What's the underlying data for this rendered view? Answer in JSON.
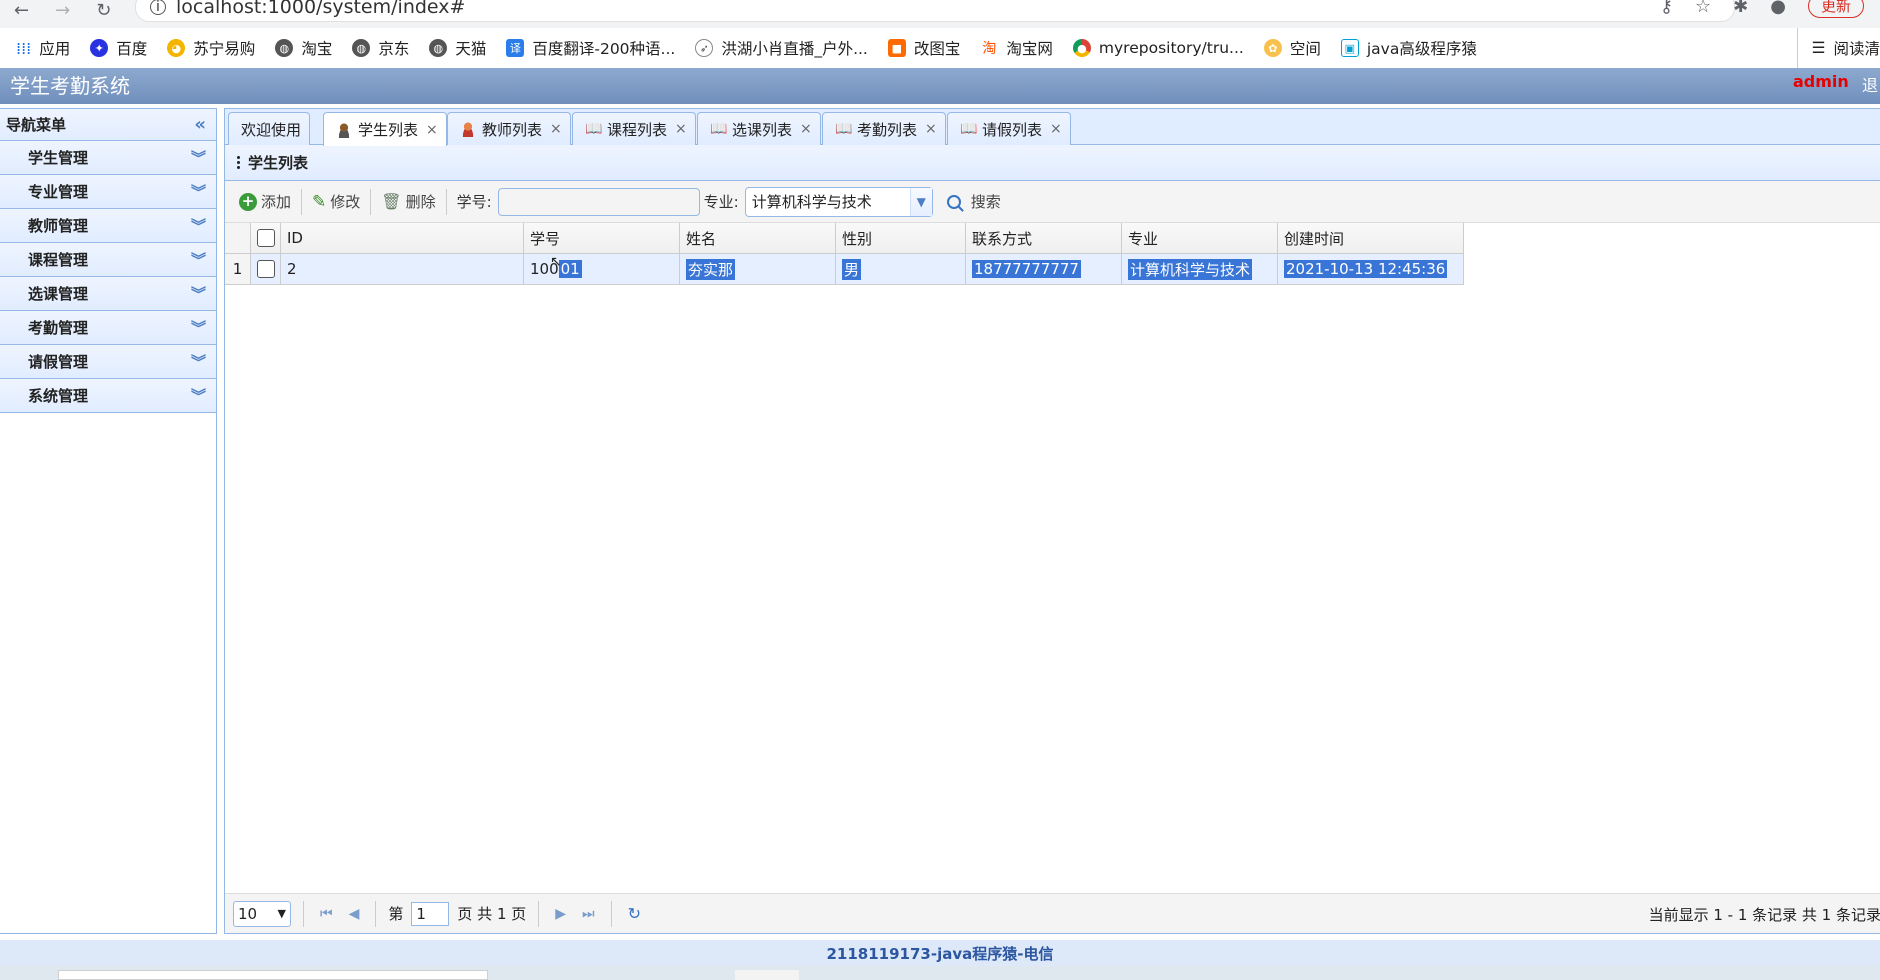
{
  "browser": {
    "url": "localhost:1000/system/index#",
    "update_label": "更新",
    "bookmarks": [
      {
        "label": "应用"
      },
      {
        "label": "百度"
      },
      {
        "label": "苏宁易购"
      },
      {
        "label": "淘宝"
      },
      {
        "label": "京东"
      },
      {
        "label": "天猫"
      },
      {
        "label": "百度翻译-200种语..."
      },
      {
        "label": "洪湖小肖直播_户外..."
      },
      {
        "label": "改图宝"
      },
      {
        "label": "淘宝网"
      },
      {
        "label": "myrepository/tru..."
      },
      {
        "label": "空间"
      },
      {
        "label": "java高级程序猿"
      }
    ],
    "reading_list": "阅读清"
  },
  "app": {
    "title": "学生考勤系统",
    "user": "admin",
    "logout": "退"
  },
  "sidebar": {
    "title": "导航菜单",
    "items": [
      {
        "label": "学生管理"
      },
      {
        "label": "专业管理"
      },
      {
        "label": "教师管理"
      },
      {
        "label": "课程管理"
      },
      {
        "label": "选课管理"
      },
      {
        "label": "考勤管理"
      },
      {
        "label": "请假管理"
      },
      {
        "label": "系统管理"
      }
    ]
  },
  "tabs": [
    {
      "label": "欢迎使用",
      "icon": "none"
    },
    {
      "label": "学生列表",
      "icon": "student-icon"
    },
    {
      "label": "教师列表",
      "icon": "teacher-icon"
    },
    {
      "label": "课程列表",
      "icon": "book-icon"
    },
    {
      "label": "选课列表",
      "icon": "book-icon"
    },
    {
      "label": "考勤列表",
      "icon": "book-icon"
    },
    {
      "label": "请假列表",
      "icon": "book-icon"
    }
  ],
  "panel": {
    "title": "学生列表"
  },
  "toolbar": {
    "add": "添加",
    "edit": "修改",
    "delete": "删除",
    "sno_label": "学号:",
    "sno_value": "",
    "major_label": "专业:",
    "major_value": "计算机科学与技术",
    "search": "搜索"
  },
  "grid": {
    "columns": [
      "ID",
      "学号",
      "姓名",
      "性别",
      "联系方式",
      "专业",
      "创建时间"
    ],
    "rows": [
      {
        "rownum": "1",
        "id": "2",
        "sno_a": "100",
        "sno_b": "01",
        "name": "夯实那",
        "gender": "男",
        "phone": "18777777777",
        "major": "计算机科学与技术",
        "created": "2021-10-13 12:45:36"
      }
    ]
  },
  "pager": {
    "page_size": "10",
    "page_prefix": "第",
    "page_num": "1",
    "page_suffix": "页 共 1 页",
    "info": "当前显示 1 - 1 条记录 共 1 条记录"
  },
  "footer": {
    "text": "2118119173-java程序猿-电信"
  },
  "colors": {
    "accent_border": "#95b8e7",
    "header_blue": "#7f9cc7",
    "selection": "#3875d7",
    "admin_red": "#e60000"
  }
}
